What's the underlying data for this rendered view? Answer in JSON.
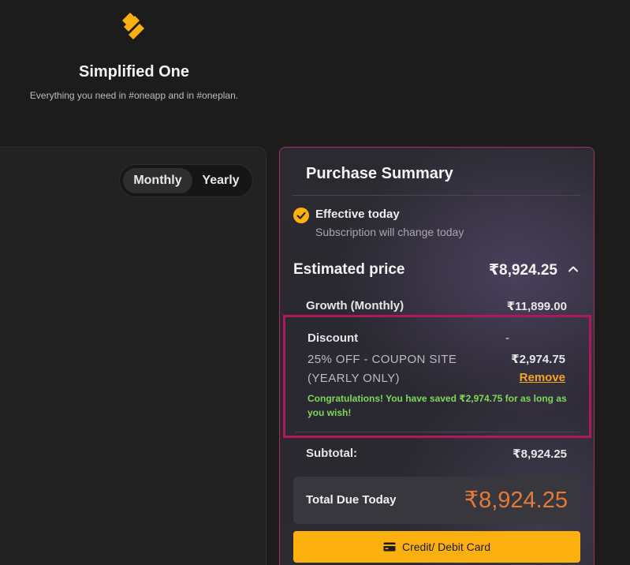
{
  "brand": {
    "name": "Simplified One",
    "tagline": "Everything you need in #oneapp and in #oneplan.",
    "accent_color": "#fbb00f"
  },
  "billing_toggle": {
    "options": [
      "Monthly",
      "Yearly"
    ],
    "selected": "Monthly"
  },
  "summary": {
    "title": "Purchase Summary",
    "effective": {
      "icon": "check-circle-icon",
      "title": "Effective today",
      "subtitle": "Subscription will change today"
    },
    "estimated": {
      "label": "Estimated price",
      "value": "₹8,924.25",
      "icon": "chevron-up-icon"
    },
    "plan_row": {
      "label": "Growth (Monthly)",
      "value": "₹11,899.00"
    },
    "discount": {
      "label": "Discount",
      "dash": "-",
      "coupon": "25% OFF - COUPON SITE (YEARLY ONLY)",
      "value": "₹2,974.75",
      "remove_label": "Remove",
      "message": "Congratulations! You have saved ₹2,974.75 for as long as you wish!"
    },
    "subtotal": {
      "label": "Subtotal:",
      "value": "₹8,924.25"
    },
    "total": {
      "label": "Total Due Today",
      "value": "₹8,924.25",
      "color": "#e27a3a"
    },
    "payment_button": {
      "label": "Credit/ Debit Card",
      "icon": "credit-card-icon"
    }
  }
}
